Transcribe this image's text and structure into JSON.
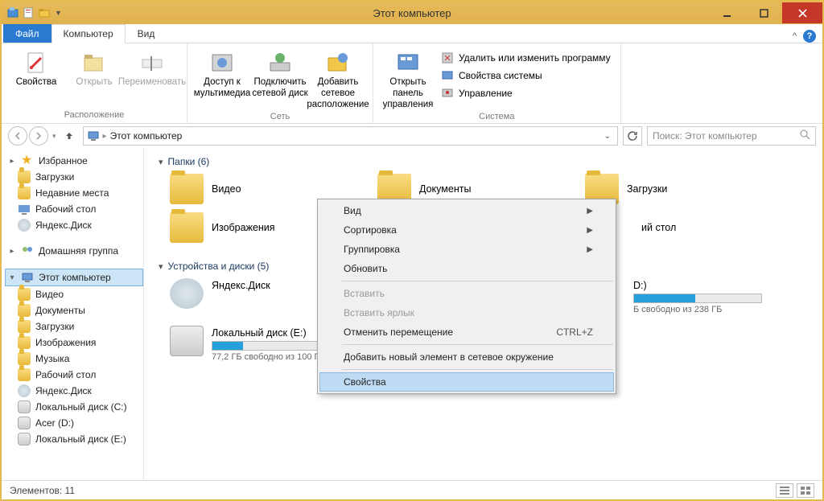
{
  "window": {
    "title": "Этот компьютер"
  },
  "tabs": {
    "file": "Файл",
    "computer": "Компьютер",
    "view": "Вид"
  },
  "ribbon": {
    "group_location": "Расположение",
    "group_network": "Сеть",
    "group_system": "Система",
    "properties": "Свойства",
    "open": "Открыть",
    "rename": "Переименовать",
    "media_access": "Доступ к мультимедиа",
    "map_drive": "Подключить сетевой диск",
    "add_net_location": "Добавить сетевое расположение",
    "control_panel": "Открыть панель управления",
    "uninstall": "Удалить или изменить программу",
    "sys_props": "Свойства системы",
    "manage": "Управление"
  },
  "nav": {
    "breadcrumb": "Этот компьютер",
    "search_placeholder": "Поиск: Этот компьютер"
  },
  "sidebar": {
    "favorites": "Избранное",
    "fav_items": [
      "Загрузки",
      "Недавние места",
      "Рабочий стол",
      "Яндекс.Диск"
    ],
    "homegroup": "Домашняя группа",
    "this_pc": "Этот компьютер",
    "pc_items": [
      "Видео",
      "Документы",
      "Загрузки",
      "Изображения",
      "Музыка",
      "Рабочий стол",
      "Яндекс.Диск",
      "Локальный диск (C:)",
      "Acer (D:)",
      "Локальный диск (E:)"
    ]
  },
  "content": {
    "folders_header": "Папки (6)",
    "folders": [
      "Видео",
      "Документы",
      "Загрузки",
      "Изображения",
      "ий стол"
    ],
    "drives_header": "Устройства и диски (5)",
    "yandex": {
      "name": "Яндекс.Диск"
    },
    "drive_d_tail": {
      "name": "D:)",
      "free": "Б свободно из 238 ГБ",
      "fill": 48
    },
    "drive_e": {
      "name": "Локальный диск (E:)",
      "free": "77,2 ГБ свободно из 100 ГБ",
      "fill": 24
    }
  },
  "context": {
    "view": "Вид",
    "sort": "Сортировка",
    "group": "Группировка",
    "refresh": "Обновить",
    "paste": "Вставить",
    "paste_shortcut": "Вставить ярлык",
    "undo_move": "Отменить перемещение",
    "undo_key": "CTRL+Z",
    "add_net": "Добавить новый элемент в сетевое окружение",
    "properties": "Свойства"
  },
  "status": {
    "items": "Элементов: 11"
  }
}
